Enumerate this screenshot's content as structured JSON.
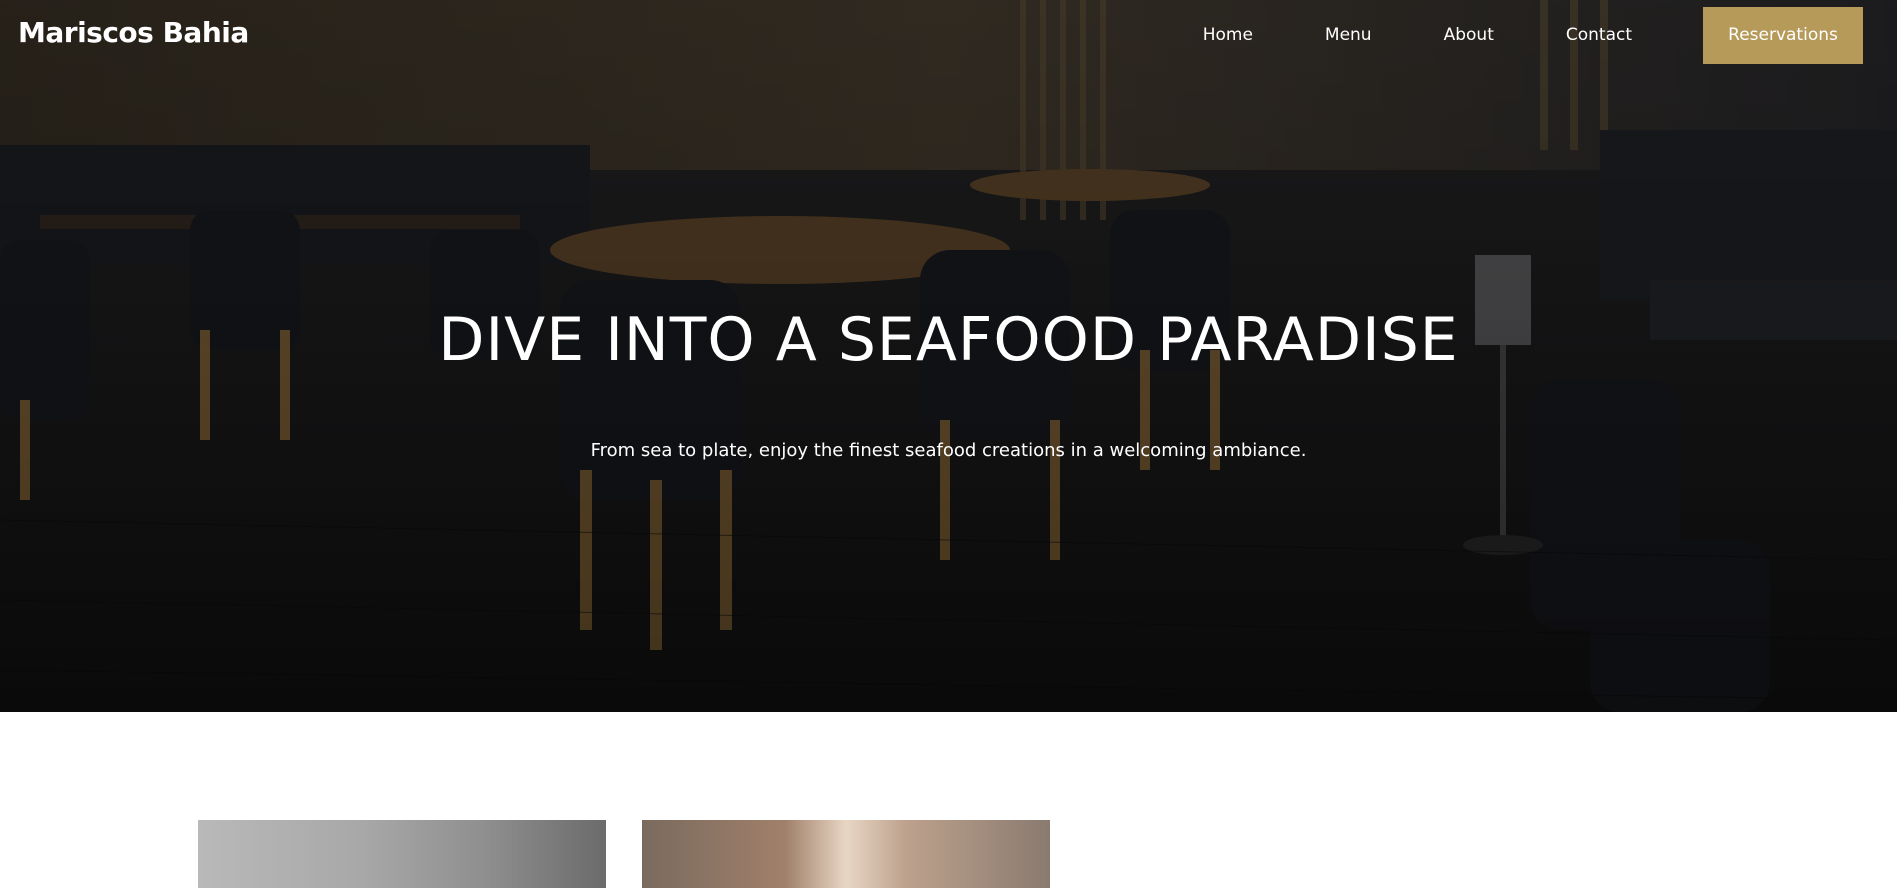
{
  "site": {
    "brand": "Mariscos Bahia"
  },
  "nav": {
    "items": [
      {
        "label": "Home"
      },
      {
        "label": "Menu"
      },
      {
        "label": "About"
      },
      {
        "label": "Contact"
      }
    ],
    "cta_label": "Reservations"
  },
  "hero": {
    "title": "DIVE INTO A SEAFOOD PARADISE",
    "subtitle": "From sea to plate, enjoy the finest seafood creations in a welcoming ambiance."
  },
  "colors": {
    "accent": "#b59a5a",
    "hero_text": "#ffffff",
    "page_bg": "#ffffff"
  },
  "gallery": {
    "cards": [
      {
        "name": "gallery-image-1"
      },
      {
        "name": "gallery-image-2"
      }
    ]
  }
}
